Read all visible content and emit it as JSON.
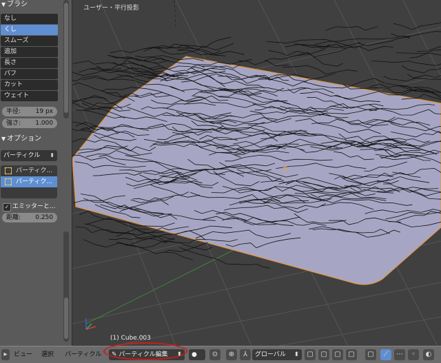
{
  "panel": {
    "brush_header": "ブラシ",
    "brushes": [
      "なし",
      "くし",
      "スムーズ",
      "追加",
      "長さ",
      "パフ",
      "カット",
      "ウェイト"
    ],
    "active_brush_index": 1,
    "radius_label": "半径:",
    "radius_value": "19 px",
    "strength_label": "強さ:",
    "strength_value": "1.000",
    "options_header": "オプション",
    "mode_select": "パーティクル",
    "list_items": [
      "パーティク...",
      "パーティク..."
    ],
    "emitter_label": "エミッターと...",
    "distance_label": "距離:",
    "distance_value": "0.250"
  },
  "viewport": {
    "view_label": "ユーザー・平行投影",
    "object_label": "(1) Cube.003"
  },
  "header": {
    "menu_view": "ビュー",
    "menu_select": "選択",
    "menu_particle": "パーティクル",
    "mode": "パーティクル編集",
    "orientation": "グローバル"
  },
  "colors": {
    "highlight": "#5f8fd2",
    "mesh_fill": "#a6a6c4",
    "mesh_outline": "#e8943a",
    "annotation": "#c81e1e"
  }
}
